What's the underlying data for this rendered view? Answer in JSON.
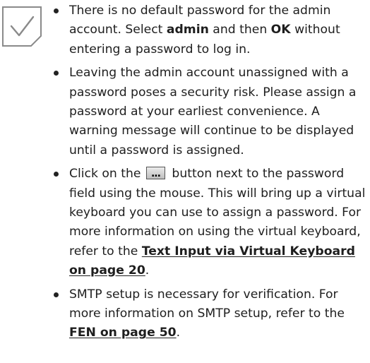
{
  "icon": "checkmark-note-icon",
  "notes": [
    {
      "p1": "There is no default password for the admin account. Select ",
      "b1": "admin",
      "p2": " and then ",
      "b2": "OK",
      "p3": " without entering a password to log in."
    },
    {
      "text": "Leaving the admin account unassigned with a password poses a security risk. Please assign a password at your earliest convenience. A warning message will continue to be displayed until a password is assigned."
    },
    {
      "p1": "Click on the ",
      "button_label": "...",
      "p2": " button next to the password field using the mouse. This will bring up a virtual keyboard you can use to assign a password. For more information on using the virtual keyboard, refer to the ",
      "link": "Text Input via Virtual Keyboard on page 20",
      "p3": "."
    },
    {
      "p1": "SMTP setup is necessary for verification. For more information on SMTP setup, refer to the ",
      "link": "FEN on page 50",
      "p2": "."
    }
  ],
  "colors": {
    "icon_stroke": "#8a8a8a",
    "text": "#1e1e1e"
  }
}
